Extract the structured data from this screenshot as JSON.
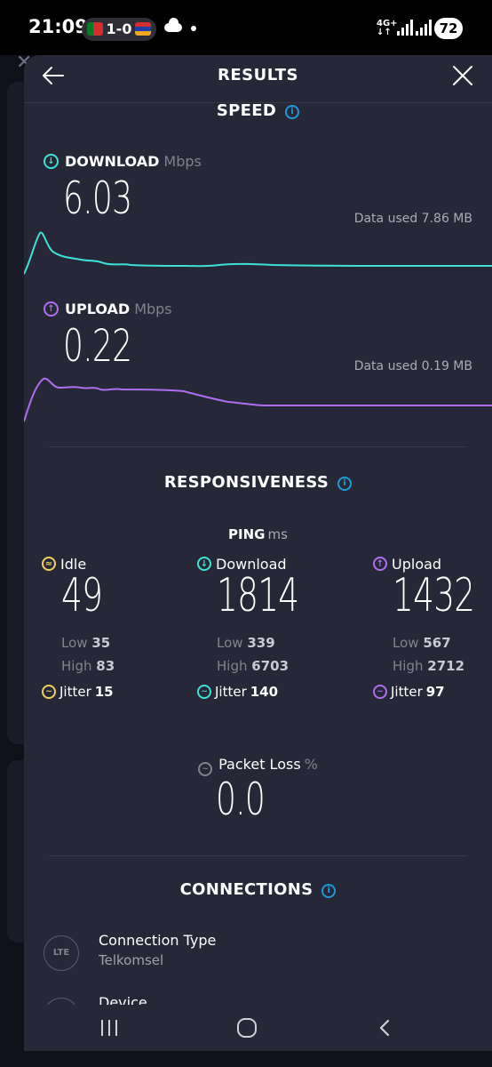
{
  "status_bar": {
    "time": "21:09",
    "score": "1-0",
    "network": "4G+",
    "battery": "72"
  },
  "header": {
    "title": "RESULTS"
  },
  "speed": {
    "section_title": "SPEED",
    "download": {
      "label": "DOWNLOAD",
      "unit": "Mbps",
      "value": "6.03",
      "data_used": "Data used 7.86 MB",
      "color": "#3ee1d6"
    },
    "upload": {
      "label": "UPLOAD",
      "unit": "Mbps",
      "value": "0.22",
      "data_used": "Data used 0.19 MB",
      "color": "#b06df2"
    }
  },
  "responsiveness": {
    "section_title": "RESPONSIVENESS",
    "ping_label": "PING",
    "ping_unit": "ms",
    "low_label": "Low",
    "high_label": "High",
    "jitter_label": "Jitter",
    "columns": [
      {
        "label": "Idle",
        "value": "49",
        "low": "35",
        "high": "83",
        "jitter": "15",
        "color": "#f3d05a"
      },
      {
        "label": "Download",
        "value": "1814",
        "low": "339",
        "high": "6703",
        "jitter": "140",
        "color": "#3ee1d6"
      },
      {
        "label": "Upload",
        "value": "1432",
        "low": "567",
        "high": "2712",
        "jitter": "97",
        "color": "#b06df2"
      }
    ],
    "packet_loss": {
      "label": "Packet Loss",
      "unit": "%",
      "value": "0.0"
    }
  },
  "connections": {
    "section_title": "CONNECTIONS",
    "items": [
      {
        "icon": "LTE",
        "title": "Connection Type",
        "value": "Telkomsel"
      },
      {
        "icon": "device-icon",
        "title": "Device",
        "value": ""
      }
    ]
  }
}
